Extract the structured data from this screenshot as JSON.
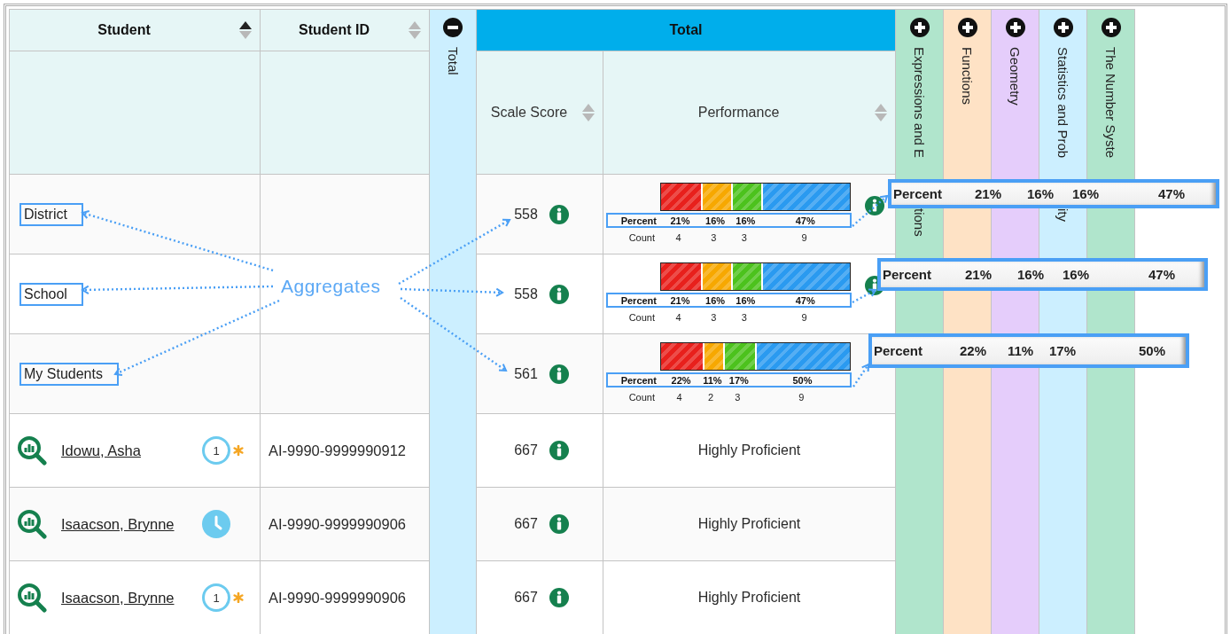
{
  "table": {
    "columns": [
      {
        "label": "Student",
        "sorted_ascending": true
      },
      {
        "label": "Student ID",
        "sorted_ascending": false
      }
    ],
    "total_column": {
      "label": "Total",
      "expanded": true
    },
    "total_group": {
      "title": "Total",
      "columns": [
        {
          "label": "Scale Score",
          "sorted_ascending": false
        },
        {
          "label": "Performance",
          "sorted_ascending": false
        }
      ]
    },
    "subjects": [
      {
        "label": "Expressions and E",
        "label_tail": "tions",
        "expanded": false,
        "color": "#b0e5cc"
      },
      {
        "label": "Functions",
        "expanded": false,
        "color": "#fee2c5"
      },
      {
        "label": "Geometry",
        "expanded": false,
        "color": "#e5cdfb"
      },
      {
        "label": "Statistics and Prob",
        "label_tail": "ity",
        "expanded": false,
        "color": "#ccefff"
      },
      {
        "label": "The Number Syste",
        "expanded": false,
        "color": "#b0e5cc"
      }
    ],
    "aggregate_rows": [
      {
        "name": "District",
        "scale_score": "558",
        "info_icon": true,
        "performance": {
          "percent_label": "Percent",
          "count_label": "Count",
          "segments": [
            {
              "percent": "21%",
              "count": "4",
              "color": "#e8201c"
            },
            {
              "percent": "16%",
              "count": "3",
              "color": "#f7a800"
            },
            {
              "percent": "16%",
              "count": "3",
              "color": "#4cc21d"
            },
            {
              "percent": "47%",
              "count": "9",
              "color": "#2a9af0"
            }
          ]
        }
      },
      {
        "name": "School",
        "scale_score": "558",
        "info_icon": true,
        "performance": {
          "percent_label": "Percent",
          "count_label": "Count",
          "segments": [
            {
              "percent": "21%",
              "count": "4",
              "color": "#e8201c"
            },
            {
              "percent": "16%",
              "count": "3",
              "color": "#f7a800"
            },
            {
              "percent": "16%",
              "count": "3",
              "color": "#4cc21d"
            },
            {
              "percent": "47%",
              "count": "9",
              "color": "#2a9af0"
            }
          ]
        }
      },
      {
        "name": "My Students",
        "scale_score": "561",
        "info_icon": false,
        "performance": {
          "percent_label": "Percent",
          "count_label": "Count",
          "segments": [
            {
              "percent": "22%",
              "count": "4",
              "color": "#e8201c"
            },
            {
              "percent": "11%",
              "count": "2",
              "color": "#f7a800"
            },
            {
              "percent": "17%",
              "count": "3",
              "color": "#4cc21d"
            },
            {
              "percent": "50%",
              "count": "9",
              "color": "#2a9af0"
            }
          ]
        }
      }
    ],
    "student_rows": [
      {
        "name": "Idowu, Asha",
        "badge": {
          "kind": "count",
          "text": "1"
        },
        "student_id": "AI-9990-9999990912",
        "scale_score": "667",
        "performance": "Highly Proficient"
      },
      {
        "name": "Isaacson, Brynne",
        "badge": {
          "kind": "clock"
        },
        "student_id": "AI-9990-9999990906",
        "scale_score": "667",
        "performance": "Highly Proficient"
      },
      {
        "name": "Isaacson, Brynne",
        "badge": {
          "kind": "count",
          "text": "1"
        },
        "student_id": "AI-9990-9999990906",
        "scale_score": "667",
        "performance": "Highly Proficient"
      }
    ]
  },
  "annotations": {
    "label": "Aggregates",
    "callouts": [
      {
        "label": "Percent",
        "values": [
          "21%",
          "16%",
          "16%",
          "47%"
        ]
      },
      {
        "label": "Percent",
        "values": [
          "21%",
          "16%",
          "16%",
          "47%"
        ]
      },
      {
        "label": "Percent",
        "values": [
          "22%",
          "11%",
          "17%",
          "50%"
        ]
      }
    ]
  }
}
